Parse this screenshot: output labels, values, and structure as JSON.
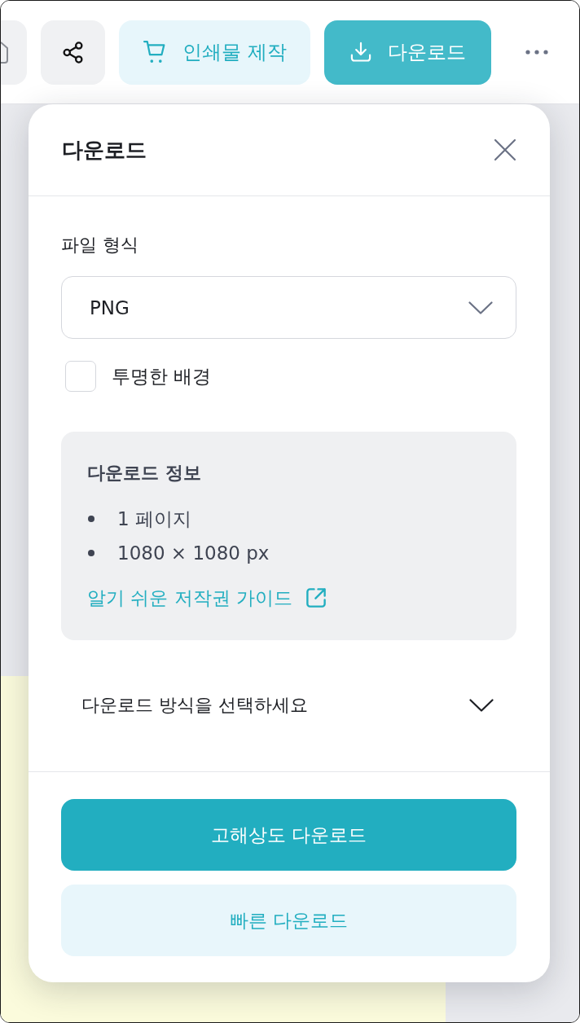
{
  "toolbar": {
    "print_button": {
      "label": "인쇄물 제작"
    },
    "download_button": {
      "label": "다운로드"
    }
  },
  "panel": {
    "title": "다운로드",
    "file_format": {
      "label": "파일 형식",
      "value": "PNG"
    },
    "transparent_background": {
      "label": "투명한 배경",
      "checked": false
    },
    "info": {
      "title": "다운로드 정보",
      "items": [
        "1 페이지",
        "1080 × 1080 px"
      ],
      "link": "알기 쉬운 저작권 가이드"
    },
    "download_method": {
      "label": "다운로드 방식을 선택하세요",
      "expanded": false
    },
    "buttons": [
      {
        "label": "고해상도 다운로드",
        "kind": "primary"
      },
      {
        "label": "빠른 다운로드",
        "kind": "secondary"
      }
    ]
  }
}
